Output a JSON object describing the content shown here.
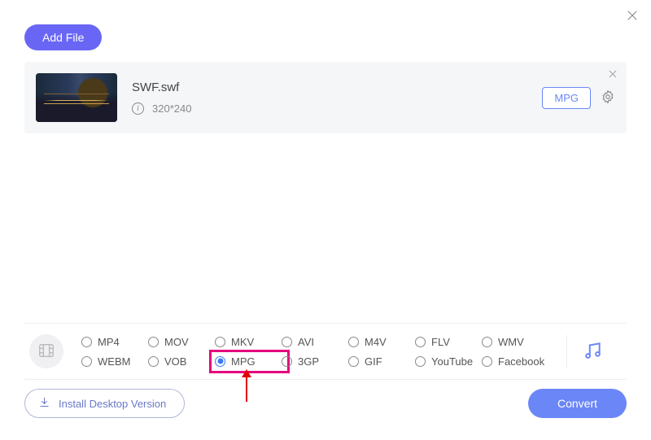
{
  "toolbar": {
    "add_file_label": "Add File"
  },
  "file": {
    "name": "SWF.swf",
    "resolution": "320*240",
    "target_format": "MPG"
  },
  "format_bar": {
    "options": [
      "MP4",
      "MOV",
      "MKV",
      "AVI",
      "M4V",
      "FLV",
      "WMV",
      "WEBM",
      "VOB",
      "MPG",
      "3GP",
      "GIF",
      "YouTube",
      "Facebook"
    ],
    "selected": "MPG"
  },
  "bottom": {
    "install_label": "Install Desktop Version",
    "convert_label": "Convert"
  }
}
